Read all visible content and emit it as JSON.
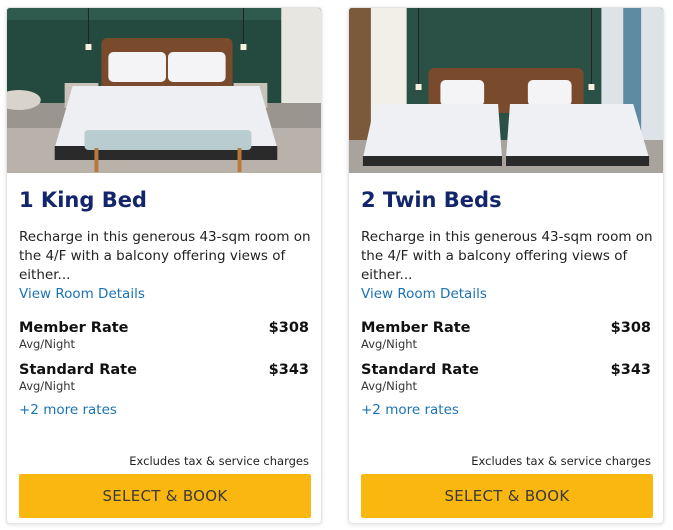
{
  "rooms": [
    {
      "title": "1 King Bed",
      "description": "Recharge in this generous 43-sqm room on the 4/F with a balcony offering views of either...",
      "details_link": "View Room Details",
      "rates": [
        {
          "name": "Member Rate",
          "price": "$308",
          "sub": "Avg/Night"
        },
        {
          "name": "Standard Rate",
          "price": "$343",
          "sub": "Avg/Night"
        }
      ],
      "more_rates": "+2 more rates",
      "disclaimer": "Excludes tax & service charges",
      "book_label": "SELECT & BOOK"
    },
    {
      "title": "2 Twin Beds",
      "description": "Recharge in this generous 43-sqm room on the 4/F with a balcony offering views of either...",
      "details_link": "View Room Details",
      "rates": [
        {
          "name": "Member Rate",
          "price": "$308",
          "sub": "Avg/Night"
        },
        {
          "name": "Standard Rate",
          "price": "$343",
          "sub": "Avg/Night"
        }
      ],
      "more_rates": "+2 more rates",
      "disclaimer": "Excludes tax & service charges",
      "book_label": "SELECT & BOOK"
    }
  ],
  "colors": {
    "title": "#14266b",
    "link": "#1b73b6",
    "button": "#f9b70f",
    "wall": "#1f4a3f"
  }
}
